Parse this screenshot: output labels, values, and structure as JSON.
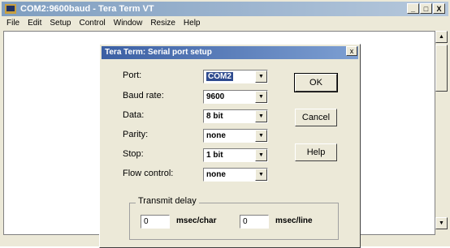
{
  "window": {
    "title": "COM2:9600baud - Tera Term VT",
    "buttons": {
      "minimize": "_",
      "maximize": "□",
      "close": "X"
    }
  },
  "menu": [
    "File",
    "Edit",
    "Setup",
    "Control",
    "Window",
    "Resize",
    "Help"
  ],
  "dialog": {
    "title": "Tera Term: Serial port setup",
    "close": "x",
    "fields": {
      "port": {
        "label": "Port:",
        "value": "COM2"
      },
      "baud": {
        "label": "Baud rate:",
        "value": "9600"
      },
      "data": {
        "label": "Data:",
        "value": "8 bit"
      },
      "parity": {
        "label": "Parity:",
        "value": "none"
      },
      "stop": {
        "label": "Stop:",
        "value": "1 bit"
      },
      "flow": {
        "label": "Flow control:",
        "value": "none"
      }
    },
    "buttons": {
      "ok": "OK",
      "cancel": "Cancel",
      "help": "Help"
    },
    "transmit_delay": {
      "title": "Transmit delay",
      "char_value": "0",
      "char_unit": "msec/char",
      "line_value": "0",
      "line_unit": "msec/line"
    }
  },
  "icons": {
    "dropdown": "chevron-down-icon",
    "app": "terminal-icon"
  },
  "colors": {
    "dialog_title": "#3b5fa3",
    "window_title": "#7f9ec0",
    "selection": "#2f4b8f"
  }
}
